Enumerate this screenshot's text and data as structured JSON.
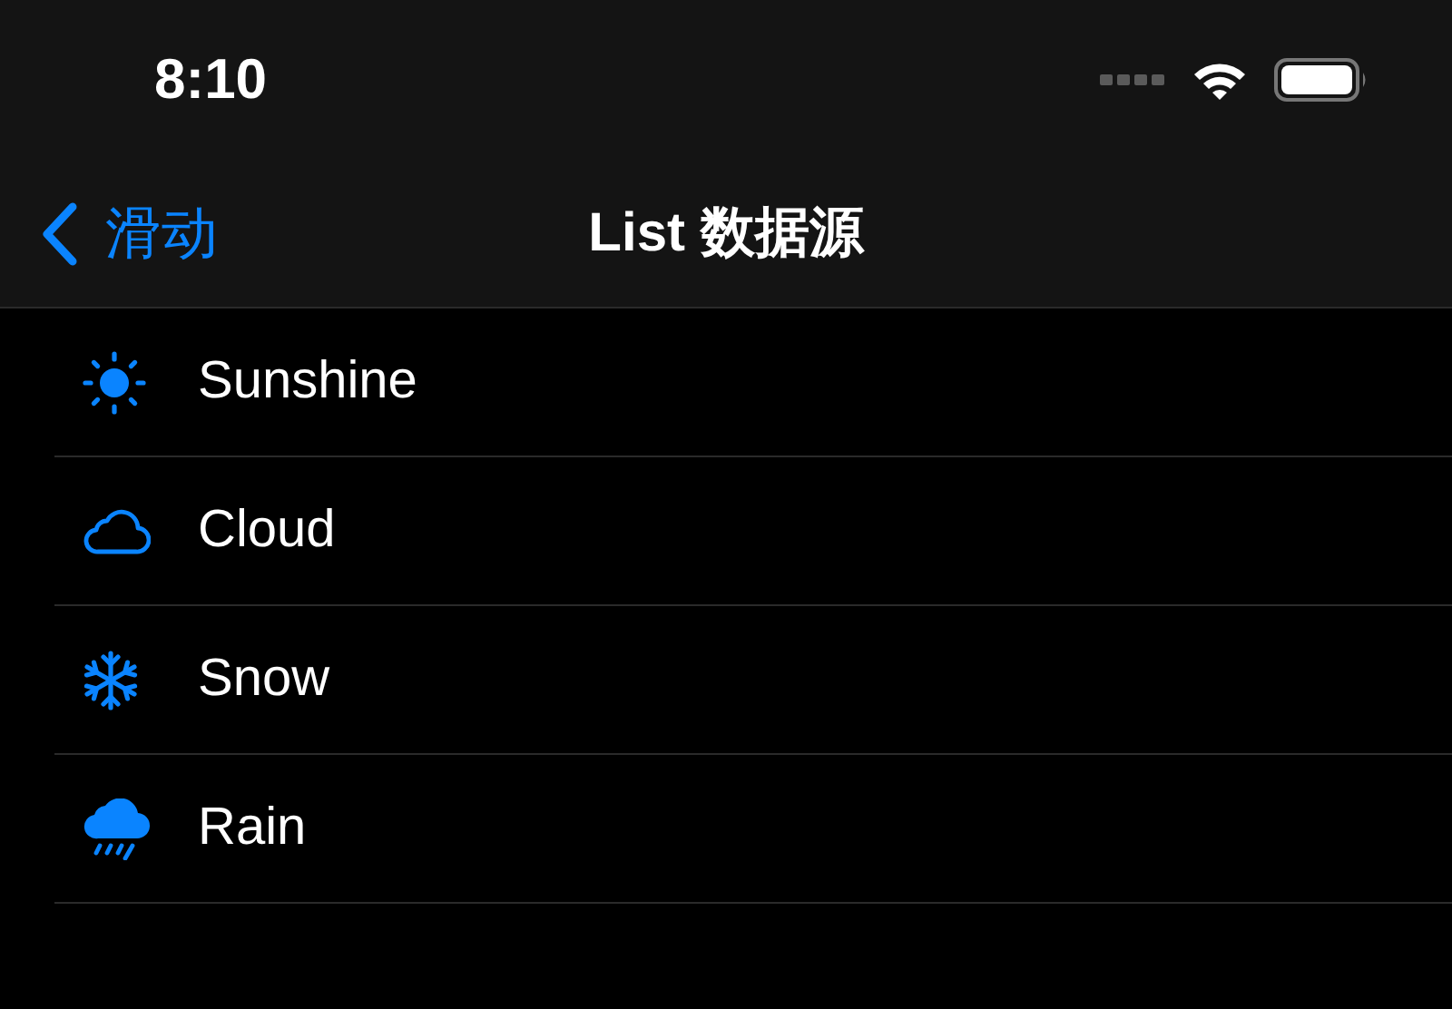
{
  "status_bar": {
    "time": "8:10"
  },
  "nav_bar": {
    "back": "滑动",
    "title": "List 数据源"
  },
  "items": [
    {
      "kind": "sun",
      "label": "Sunshine"
    },
    {
      "kind": "cloud",
      "label": "Cloud"
    },
    {
      "kind": "snow",
      "label": "Snow"
    },
    {
      "kind": "rain",
      "label": "Rain"
    }
  ]
}
